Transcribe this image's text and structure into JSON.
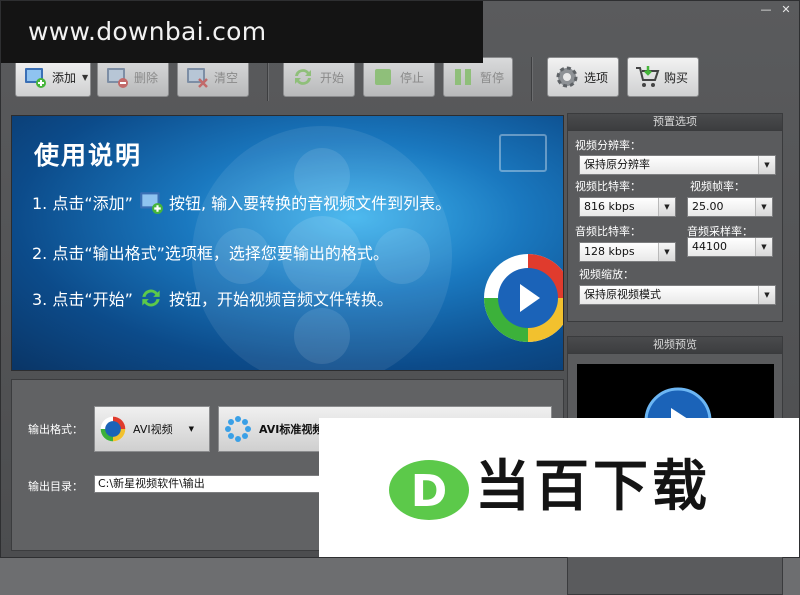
{
  "watermark": {
    "text": "www.downbai.com"
  },
  "window_controls": {
    "minimize": "—",
    "close": "✕"
  },
  "toolbar": {
    "add_label": "添加",
    "delete_label": "删除",
    "clear_label": "清空",
    "start_label": "开始",
    "stop_label": "停止",
    "pause_label": "暂停",
    "options_label": "选项",
    "buy_label": "购买"
  },
  "banner": {
    "title": "使用说明",
    "step1_a": "1. 点击“添加”",
    "step1_b": "按钮, 输入要转换的音视频文件到列表。",
    "step2": "2. 点击“输出格式”选项框，选择您要输出的格式。",
    "step3_a": "3. 点击“开始”",
    "step3_b": "按钮，开始视频音频文件转换。"
  },
  "preset": {
    "header": "预置选项",
    "resolution_label": "视频分辨率：",
    "resolution_value": "保持原分辨率",
    "video_bitrate_label": "视频比特率：",
    "video_bitrate_value": "816 kbps",
    "framerate_label": "视频帧率：",
    "framerate_value": "25.00",
    "audio_bitrate_label": "音频比特率：",
    "audio_bitrate_value": "128 kbps",
    "samplerate_label": "音频采样率：",
    "samplerate_value": "44100",
    "scale_label": "视频缩放：",
    "scale_value": "保持原视频模式"
  },
  "preview": {
    "header": "视频预览"
  },
  "output": {
    "format_label": "输出格式：",
    "format_value": "AVI视频",
    "format_standard": "AVI标准视频",
    "dir_label": "输出目录：",
    "dir_value": "C:\\新星视频软件\\输出"
  },
  "logo": {
    "text": "当百下载",
    "letter": "D"
  },
  "colors": {
    "accent_green": "#5cc94a",
    "banner_blue": "#1a78bf"
  }
}
